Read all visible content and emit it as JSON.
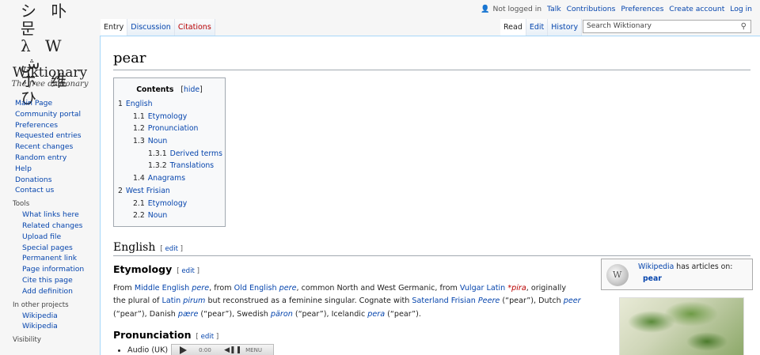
{
  "logo": {
    "glyph_rows": [
      "シ 卟 문",
      "λ W ش",
      "ホ 维 ひ"
    ],
    "name": "Wiktionary",
    "tagline": "The free dictionary"
  },
  "nav": {
    "items": [
      "Main Page",
      "Community portal",
      "Preferences",
      "Requested entries",
      "Recent changes",
      "Random entry",
      "Help",
      "Donations",
      "Contact us"
    ]
  },
  "tools": {
    "heading": "Tools",
    "items": [
      "What links here",
      "Related changes",
      "Upload file",
      "Special pages",
      "Permanent link",
      "Page information",
      "Cite this page",
      "Add definition"
    ]
  },
  "other_projects": {
    "heading": "In other projects",
    "items": [
      "Wikipedia",
      "Wikipedia"
    ]
  },
  "visibility": {
    "heading": "Visibility"
  },
  "personal": {
    "not_logged_in": "Not logged in",
    "links": [
      "Talk",
      "Contributions",
      "Preferences",
      "Create account",
      "Log in"
    ]
  },
  "tabs": {
    "left": [
      {
        "label": "Entry",
        "selected": true
      },
      {
        "label": "Discussion"
      },
      {
        "label": "Citations",
        "new": true
      }
    ],
    "right": [
      {
        "label": "Read",
        "selected": true
      },
      {
        "label": "Edit"
      },
      {
        "label": "History"
      }
    ]
  },
  "search": {
    "placeholder": "Search Wiktionary"
  },
  "page": {
    "title": "pear",
    "toc": {
      "title": "Contents",
      "hide": "hide",
      "entries": [
        {
          "num": "1",
          "label": "English",
          "level": 1
        },
        {
          "num": "1.1",
          "label": "Etymology",
          "level": 2
        },
        {
          "num": "1.2",
          "label": "Pronunciation",
          "level": 2
        },
        {
          "num": "1.3",
          "label": "Noun",
          "level": 2
        },
        {
          "num": "1.3.1",
          "label": "Derived terms",
          "level": 3
        },
        {
          "num": "1.3.2",
          "label": "Translations",
          "level": 3
        },
        {
          "num": "1.4",
          "label": "Anagrams",
          "level": 2
        },
        {
          "num": "2",
          "label": "West Frisian",
          "level": 1
        },
        {
          "num": "2.1",
          "label": "Etymology",
          "level": 2
        },
        {
          "num": "2.2",
          "label": "Noun",
          "level": 2
        }
      ]
    },
    "english_heading": "English",
    "edit_label": "edit",
    "etymology_heading": "Etymology",
    "pronunciation_heading": "Pronunciation",
    "etymology": {
      "from": "From ",
      "me_link": "Middle English",
      "pere1": "pere",
      "comma_from": ", from ",
      "oe_link": "Old English",
      "pere2": "pere",
      "common": ", common North and West Germanic, from ",
      "vl_link": "Vulgar Latin",
      "pira": "*pira",
      "orig": ", originally",
      "plural_of": "the plural of ",
      "latin_link": "Latin",
      "pirum": "pirum",
      "but": " but reconstrued as a feminine singular. Cognate with ",
      "sf_link": "Saterland Frisian",
      "peere": "Peere",
      "pear_gloss1": " (“pear”), Dutch ",
      "peer": "peer",
      "pear_gloss2": "(“pear”), Danish ",
      "paere": "pære",
      "pear_gloss3": " (“pear”), Swedish ",
      "paron": "päron",
      "pear_gloss4": " (“pear”), Icelandic ",
      "pera": "pera",
      "pear_gloss5": " (“pear”)."
    },
    "wikibox": {
      "link": "Wikipedia",
      "text": " has articles on:",
      "article": "pear"
    },
    "audio": {
      "label": "Audio (UK)",
      "time": "0:00",
      "menu": "MENU"
    }
  }
}
